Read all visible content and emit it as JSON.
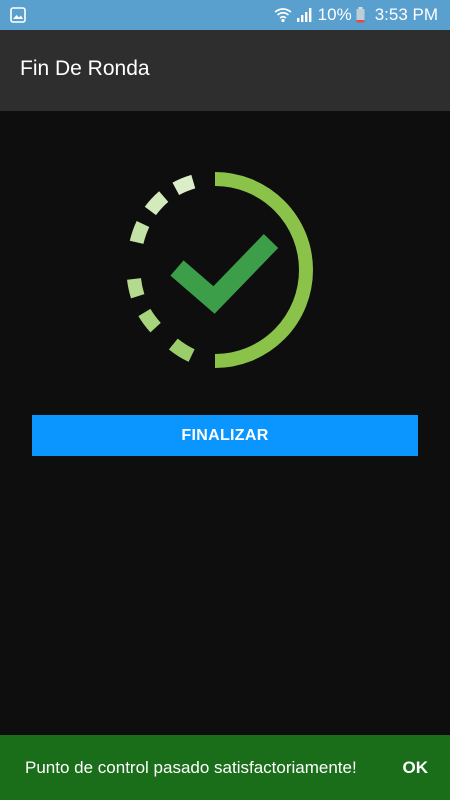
{
  "status_bar": {
    "left_icon": "image-icon",
    "wifi_icon": "wifi-icon",
    "signal_icon": "signal-icon",
    "battery_percent": "10%",
    "battery_icon": "battery-icon",
    "time": "3:53 PM",
    "background_color": "#5aa0cf"
  },
  "app_bar": {
    "title": "Fin De Ronda",
    "background_color": "#2e2e2e"
  },
  "main": {
    "graphic": "checkmark-progress-icon",
    "button_label": "FINALIZAR",
    "button_color": "#0a95ff"
  },
  "snackbar": {
    "message": "Punto de control pasado satisfactoriamente!",
    "action_label": "OK",
    "background_color": "#1a6e1a"
  }
}
